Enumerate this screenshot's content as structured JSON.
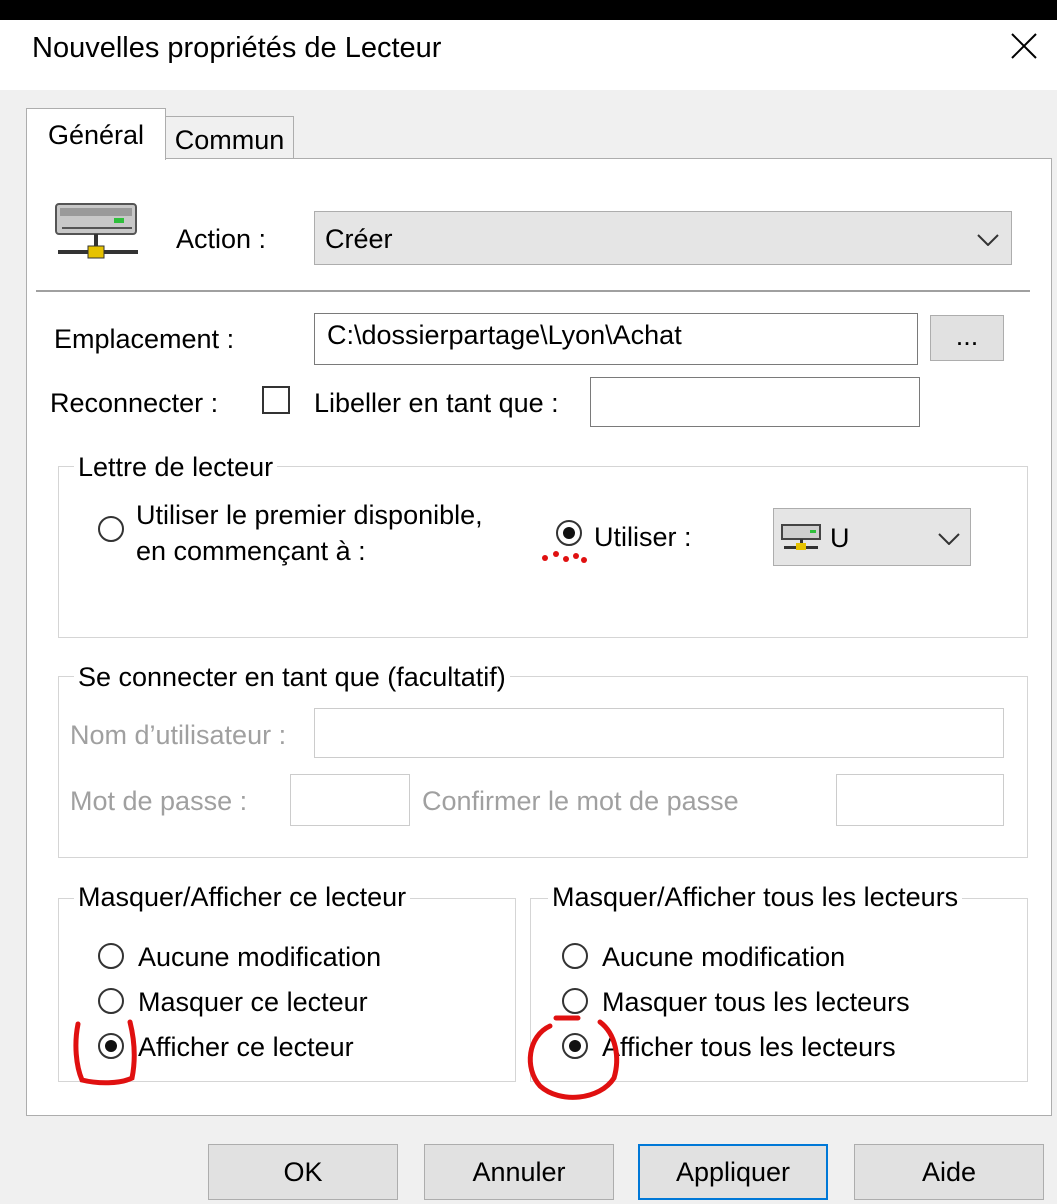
{
  "window": {
    "title": "Nouvelles propriétés de Lecteur"
  },
  "tabs": [
    {
      "label": "Général"
    },
    {
      "label": "Commun"
    }
  ],
  "action": {
    "label": "Action :",
    "value": "Créer"
  },
  "location": {
    "label": "Emplacement :",
    "value": "C:\\dossierpartage\\Lyon\\Achat",
    "browse_label": "..."
  },
  "reconnect": {
    "label": "Reconnecter :",
    "checked": false
  },
  "label_as": {
    "label": "Libeller en tant que :",
    "value": ""
  },
  "drive_letter": {
    "legend": "Lettre de lecteur",
    "option_first_line1": "Utiliser le premier disponible,",
    "option_first_line2": "en commençant à :",
    "option_use": "Utiliser :",
    "selected": "use",
    "letter": "U"
  },
  "connect_as": {
    "legend": "Se connecter en tant que (facultatif)",
    "username_label": "Nom d’utilisateur :",
    "password_label": "Mot de passe :",
    "confirm_label": "Confirmer le mot de passe"
  },
  "hide_this": {
    "legend": "Masquer/Afficher ce lecteur",
    "options": [
      "Aucune modification",
      "Masquer ce lecteur",
      "Afficher ce lecteur"
    ],
    "selected_index": 2
  },
  "hide_all": {
    "legend": "Masquer/Afficher tous les lecteurs",
    "options": [
      "Aucune modification",
      "Masquer tous les lecteurs",
      "Afficher tous les lecteurs"
    ],
    "selected_index": 2
  },
  "buttons": {
    "ok": "OK",
    "cancel": "Annuler",
    "apply": "Appliquer",
    "help": "Aide"
  },
  "colors": {
    "annotation": "#e01010",
    "focus": "#0078d7"
  }
}
